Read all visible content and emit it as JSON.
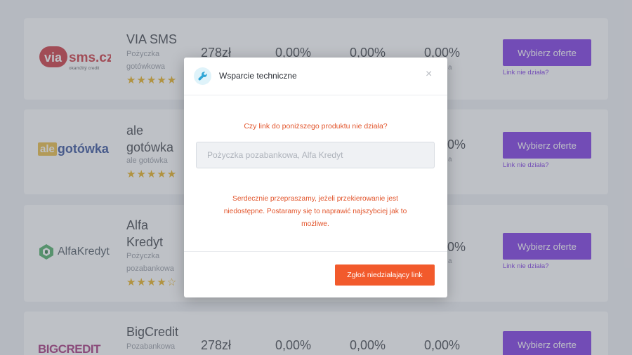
{
  "offers": [
    {
      "name": "VIA SMS",
      "type_line1": "Pożyczka",
      "type_line2": "gotówkowa",
      "stars": "★★★★★",
      "amount": "278zł",
      "rate1": "0,00%",
      "rate2": "0,00%",
      "rate3": "0,00%",
      "rate3_sub": "a",
      "button": "Wybierz oferte",
      "link": "Link nie działa?",
      "logo_main": "via",
      "logo_accent": "sms.cz",
      "logo_sub": "okamžitý credit"
    },
    {
      "name_line1": "ale",
      "name_line2": "gotówka",
      "type_line1": "ale gotówka",
      "stars": "★★★★★",
      "rate3": "0%",
      "rate3_sub": "a",
      "button": "Wybierz oferte",
      "link": "Link nie działa?",
      "logo_box": "ale",
      "logo_text": "gotówka"
    },
    {
      "name_line1": "Alfa",
      "name_line2": "Kredyt",
      "type_line1": "Pożyczka",
      "type_line2": "pozabankowa",
      "stars": "★★★★☆",
      "rate3": "0%",
      "rate3_sub": "a",
      "button": "Wybierz oferte",
      "link": "Link nie działa?",
      "logo_text": "AlfaKredyt"
    },
    {
      "name": "BigCredit",
      "type_line1": "Pozabankowa",
      "amount": "278zł",
      "rate1": "0,00%",
      "rate2": "0,00%",
      "rate3": "0,00%",
      "button": "Wybierz oferte",
      "logo_text": "BIGCREDIT"
    }
  ],
  "modal": {
    "title": "Wsparcie techniczne",
    "close": "×",
    "question": "Czy link do poniższego produktu nie działa?",
    "input_placeholder": "Pożyczka pozabankowa, Alfa Kredyt",
    "message": "Serdecznie przepraszamy, jeżeli przekierowanie jest niedostępne. Postaramy się to naprawić najszybciej jak to możliwe.",
    "submit": "Zgłoś niedziałający link"
  },
  "colors": {
    "primary": "#6d1fe0",
    "accent": "#f25a2c",
    "warning_text": "#e2552c",
    "stars": "#e6a700"
  },
  "icons": {
    "modal_icon": "wrench-icon"
  }
}
